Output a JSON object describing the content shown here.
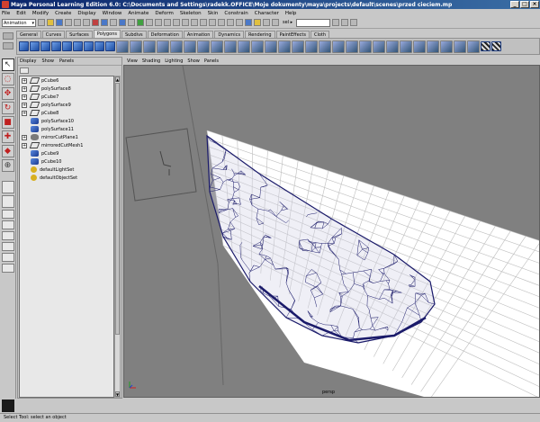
{
  "window": {
    "title": "Maya Personal Learning Edition 6.0: C:\\Documents and Settings\\radekk.OFFICE\\Moje dokumenty\\maya\\projects\\default\\scenes\\przed cieciem.mp",
    "minimize": "_",
    "maximize": "□",
    "close": "×"
  },
  "menubar": [
    "File",
    "Edit",
    "Modify",
    "Create",
    "Display",
    "Window",
    "Animate",
    "Deform",
    "Skeleton",
    "Skin",
    "Constrain",
    "Character",
    "Help"
  ],
  "statusline": {
    "menu_set": "Animation",
    "sel_label": "sel ▸"
  },
  "shelf": {
    "tabs": [
      "General",
      "Curves",
      "Surfaces",
      "Polygons",
      "Subdivs",
      "Deformation",
      "Animation",
      "Dynamics",
      "Rendering",
      "PaintEffects",
      "Cloth"
    ],
    "active_tab": "Polygons"
  },
  "outliner": {
    "menu": [
      "Display",
      "Show",
      "Panels"
    ],
    "items": [
      {
        "label": "pCube6",
        "expandable": true,
        "icon": "curve-icon"
      },
      {
        "label": "polySurface8",
        "expandable": true,
        "icon": "curve-icon"
      },
      {
        "label": "pCube7",
        "expandable": true,
        "icon": "curve-icon"
      },
      {
        "label": "polySurface9",
        "expandable": true,
        "icon": "curve-icon"
      },
      {
        "label": "pCube8",
        "expandable": true,
        "icon": "curve-icon"
      },
      {
        "label": "polySurface10",
        "expandable": false,
        "icon": "mesh-icon"
      },
      {
        "label": "polySurface11",
        "expandable": false,
        "icon": "mesh-icon"
      },
      {
        "label": "mirrorCutPlane1",
        "expandable": true,
        "icon": "plane-icon"
      },
      {
        "label": "mirroredCutMesh1",
        "expandable": true,
        "icon": "curve-icon"
      },
      {
        "label": "pCube9",
        "expandable": false,
        "icon": "mesh-icon"
      },
      {
        "label": "pCube10",
        "expandable": false,
        "icon": "mesh-icon"
      },
      {
        "label": "defaultLightSet",
        "expandable": false,
        "icon": "set-icon"
      },
      {
        "label": "defaultObjectSet",
        "expandable": false,
        "icon": "set-icon"
      }
    ]
  },
  "viewport": {
    "menu": [
      "View",
      "Shading",
      "Lighting",
      "Show",
      "Panels"
    ],
    "camera": "persp"
  },
  "helpline": "Select Tool: select an object",
  "colors": {
    "viewport_bg": "#808080",
    "wireframe": "#1a1a6a",
    "grid": "#ffffff"
  }
}
